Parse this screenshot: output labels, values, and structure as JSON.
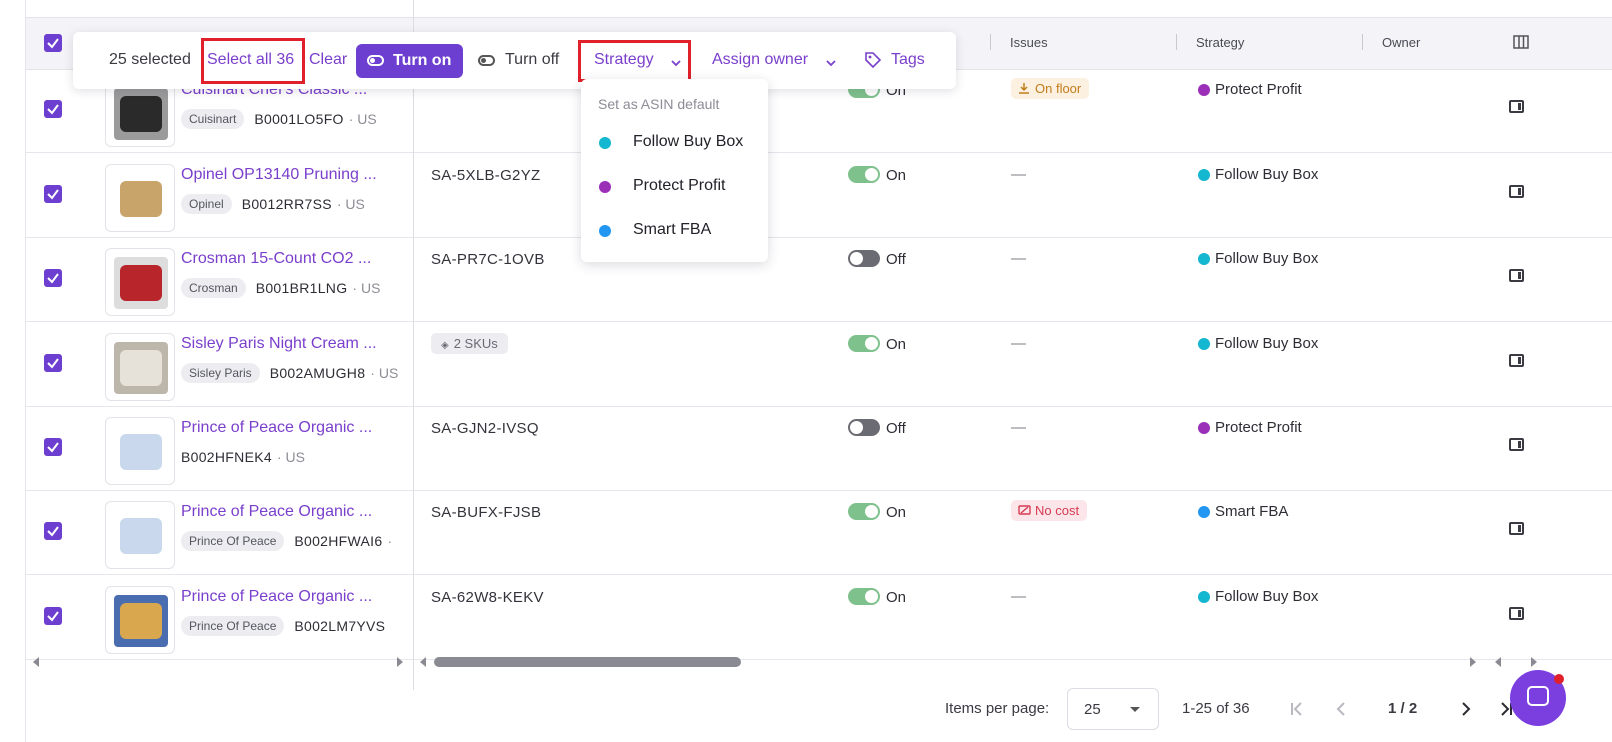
{
  "header": {
    "columns": [
      "Issues",
      "Strategy",
      "Owner"
    ],
    "columns_icon": "columns-icon"
  },
  "bulk_bar": {
    "selected_count": "25 selected",
    "select_all": "Select all 36",
    "clear": "Clear",
    "turn_on": "Turn on",
    "turn_off": "Turn off",
    "strategy": "Strategy",
    "assign_owner": "Assign owner",
    "tags": "Tags"
  },
  "strategy_menu": {
    "header": "Set as ASIN default",
    "items": [
      {
        "label": "Follow Buy Box",
        "color": "#13b7cf"
      },
      {
        "label": "Protect Profit",
        "color": "#9b2fb8"
      },
      {
        "label": "Smart FBA",
        "color": "#2196f3"
      }
    ]
  },
  "rows": [
    {
      "title": "Cuisinart Chef's Classic ...",
      "brand": "Cuisinart",
      "asin": "B0001LO5FO",
      "region": "· US",
      "sku": "",
      "sku_chip": "",
      "enabled": "On",
      "issue": "On floor",
      "strategy": "Protect Profit",
      "strategy_color": "#9b2fb8",
      "selected": true
    },
    {
      "title": "Opinel OP13140 Pruning ...",
      "brand": "Opinel",
      "asin": "B0012RR7SS",
      "region": "· US",
      "sku": "SA-5XLB-G2YZ",
      "sku_chip": "",
      "enabled": "On",
      "issue": "—",
      "strategy": "Follow Buy Box",
      "strategy_color": "#13b7cf",
      "selected": true
    },
    {
      "title": "Crosman 15-Count CO2 ...",
      "brand": "Crosman",
      "asin": "B001BR1LNG",
      "region": "· US",
      "sku": "SA-PR7C-1OVB",
      "sku_chip": "",
      "enabled": "Off",
      "issue": "—",
      "strategy": "Follow Buy Box",
      "strategy_color": "#13b7cf",
      "selected": true
    },
    {
      "title": "Sisley Paris Night Cream ...",
      "brand": "Sisley Paris",
      "asin": "B002AMUGH8",
      "region": "· US",
      "sku": "",
      "sku_chip": "2 SKUs",
      "enabled": "On",
      "issue": "—",
      "strategy": "Follow Buy Box",
      "strategy_color": "#13b7cf",
      "selected": true
    },
    {
      "title": "Prince of Peace Organic ...",
      "brand": "",
      "asin": "B002HFNEK4",
      "region": "· US",
      "sku": "SA-GJN2-IVSQ",
      "sku_chip": "",
      "enabled": "Off",
      "issue": "—",
      "strategy": "Protect Profit",
      "strategy_color": "#9b2fb8",
      "selected": true
    },
    {
      "title": "Prince of Peace Organic ...",
      "brand": "Prince Of Peace",
      "asin": "B002HFWAI6",
      "region": "·",
      "sku": "SA-BUFX-FJSB",
      "sku_chip": "",
      "enabled": "On",
      "issue": "No cost",
      "strategy": "Smart FBA",
      "strategy_color": "#2196f3",
      "selected": true
    },
    {
      "title": "Prince of Peace Organic ...",
      "brand": "Prince Of Peace",
      "asin": "B002LM7YVS",
      "region": "",
      "sku": "SA-62W8-KEKV",
      "sku_chip": "",
      "enabled": "On",
      "issue": "—",
      "strategy": "Follow Buy Box",
      "strategy_color": "#13b7cf",
      "selected": true
    }
  ],
  "footer": {
    "items_per_page_label": "Items per page:",
    "items_per_page_value": "25",
    "range": "1-25 of 36",
    "page": "1 / 2"
  },
  "colors": {
    "accent": "#6d3fd1",
    "link": "#7a3fcc",
    "highlight_box": "#e0202a"
  }
}
